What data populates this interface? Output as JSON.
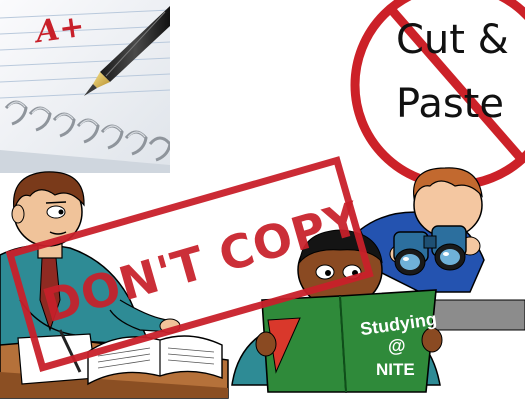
{
  "notebook": {
    "grade": "A+"
  },
  "no_cut_paste": {
    "line1": "Cut &",
    "line2": "Paste"
  },
  "stamp": {
    "text": "DON'T COPY"
  },
  "book": {
    "line1": "Studying",
    "line2": "@",
    "line3": "NITE"
  },
  "colors": {
    "stamp_red": "#c8202a",
    "no_sign_red": "#cc2128",
    "book_green": "#2f8a3a",
    "binoculars_blue": "#2c6f9e",
    "cheater_shirt": "#2e8b95",
    "grade_red": "#c8202a"
  },
  "icons": [
    "notebook-pen-photo",
    "no-sign-icon",
    "binoculars-icon"
  ]
}
